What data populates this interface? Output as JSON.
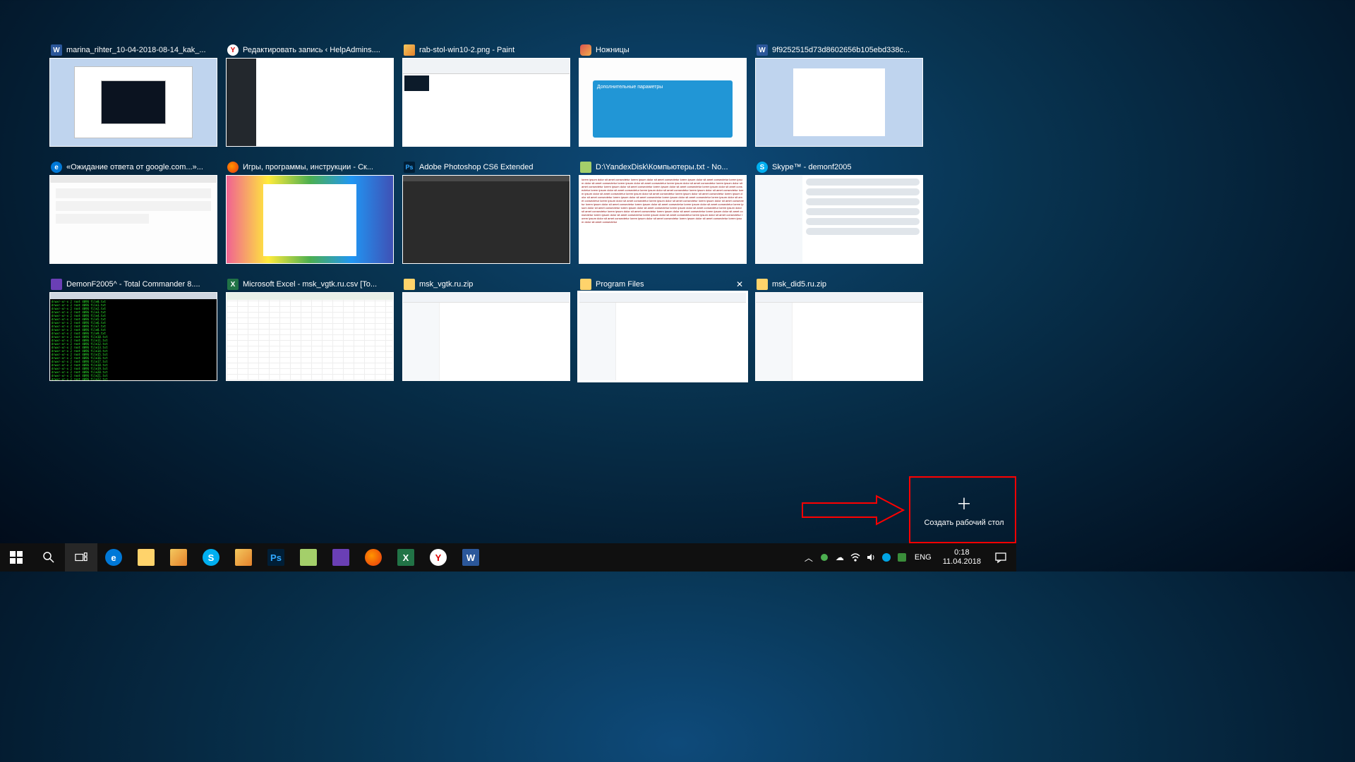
{
  "task_view": {
    "rows": [
      [
        {
          "icon": "word",
          "title": "marina_rihter_10-04-2018-08-14_kak_..."
        },
        {
          "icon": "yandex",
          "title": "Редактировать запись ‹ HelpAdmins...."
        },
        {
          "icon": "paint",
          "title": "rab-stol-win10-2.png - Paint"
        },
        {
          "icon": "snip",
          "title": "Ножницы"
        },
        {
          "icon": "word",
          "title": "9f9252515d73d8602656b105ebd338c..."
        }
      ],
      [
        {
          "icon": "edge",
          "title": "«Ожидание ответа от google.com...»..."
        },
        {
          "icon": "firefox",
          "title": "Игры, программы, инструкции - Ск..."
        },
        {
          "icon": "ps",
          "title": "Adobe Photoshop CS6 Extended"
        },
        {
          "icon": "npp",
          "title": "D:\\YandexDisk\\Компьютеры.txt - No..."
        },
        {
          "icon": "skype",
          "title": "Skype™ - demonf2005"
        }
      ],
      [
        {
          "icon": "tc",
          "title": "DemonF2005^ - Total Commander 8...."
        },
        {
          "icon": "excel",
          "title": "Microsoft Excel - msk_vgtk.ru.csv  [To..."
        },
        {
          "icon": "folder",
          "title": "msk_vgtk.ru.zip"
        },
        {
          "icon": "folder",
          "title": "Program Files",
          "selected": true
        },
        {
          "icon": "folder",
          "title": "msk_did5.ru.zip"
        }
      ]
    ]
  },
  "new_desktop_label": "Создать рабочий стол",
  "snip_panel_title": "Дополнительные параметры",
  "taskbar": {
    "lang": "ENG",
    "time": "0:18",
    "date": "11.04.2018"
  }
}
